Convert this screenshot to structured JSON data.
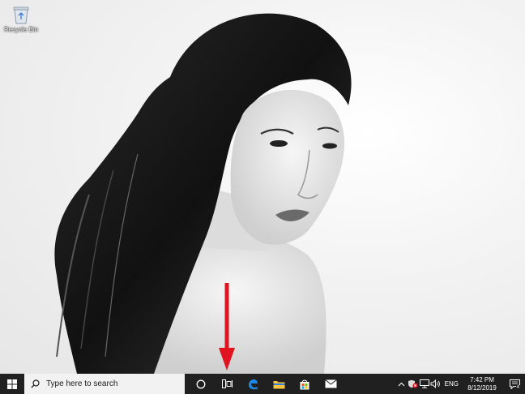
{
  "desktop": {
    "recycle_bin": {
      "label": "Recycle Bin",
      "icon": "recycle-bin-icon"
    }
  },
  "taskbar": {
    "start_icon": "windows-logo-icon",
    "search": {
      "placeholder": "Type here to search",
      "icon": "search-icon"
    },
    "cortana_icon": "cortana-circle-icon",
    "task_view_icon": "task-view-icon",
    "pinned_apps": [
      {
        "name": "Microsoft Edge",
        "icon": "edge-icon",
        "color": "#1e88e5"
      },
      {
        "name": "File Explorer",
        "icon": "folder-icon",
        "color": "#f4c542"
      },
      {
        "name": "Microsoft Store",
        "icon": "store-icon",
        "color": "#e85d2a"
      },
      {
        "name": "Mail",
        "icon": "mail-icon",
        "color": "#ffffff"
      }
    ],
    "tray": {
      "language": "ENG",
      "time": "7:42 PM",
      "date": "8/12/2019",
      "notification_count": "4"
    }
  },
  "annotation": {
    "arrow_color": "#e0141e"
  }
}
